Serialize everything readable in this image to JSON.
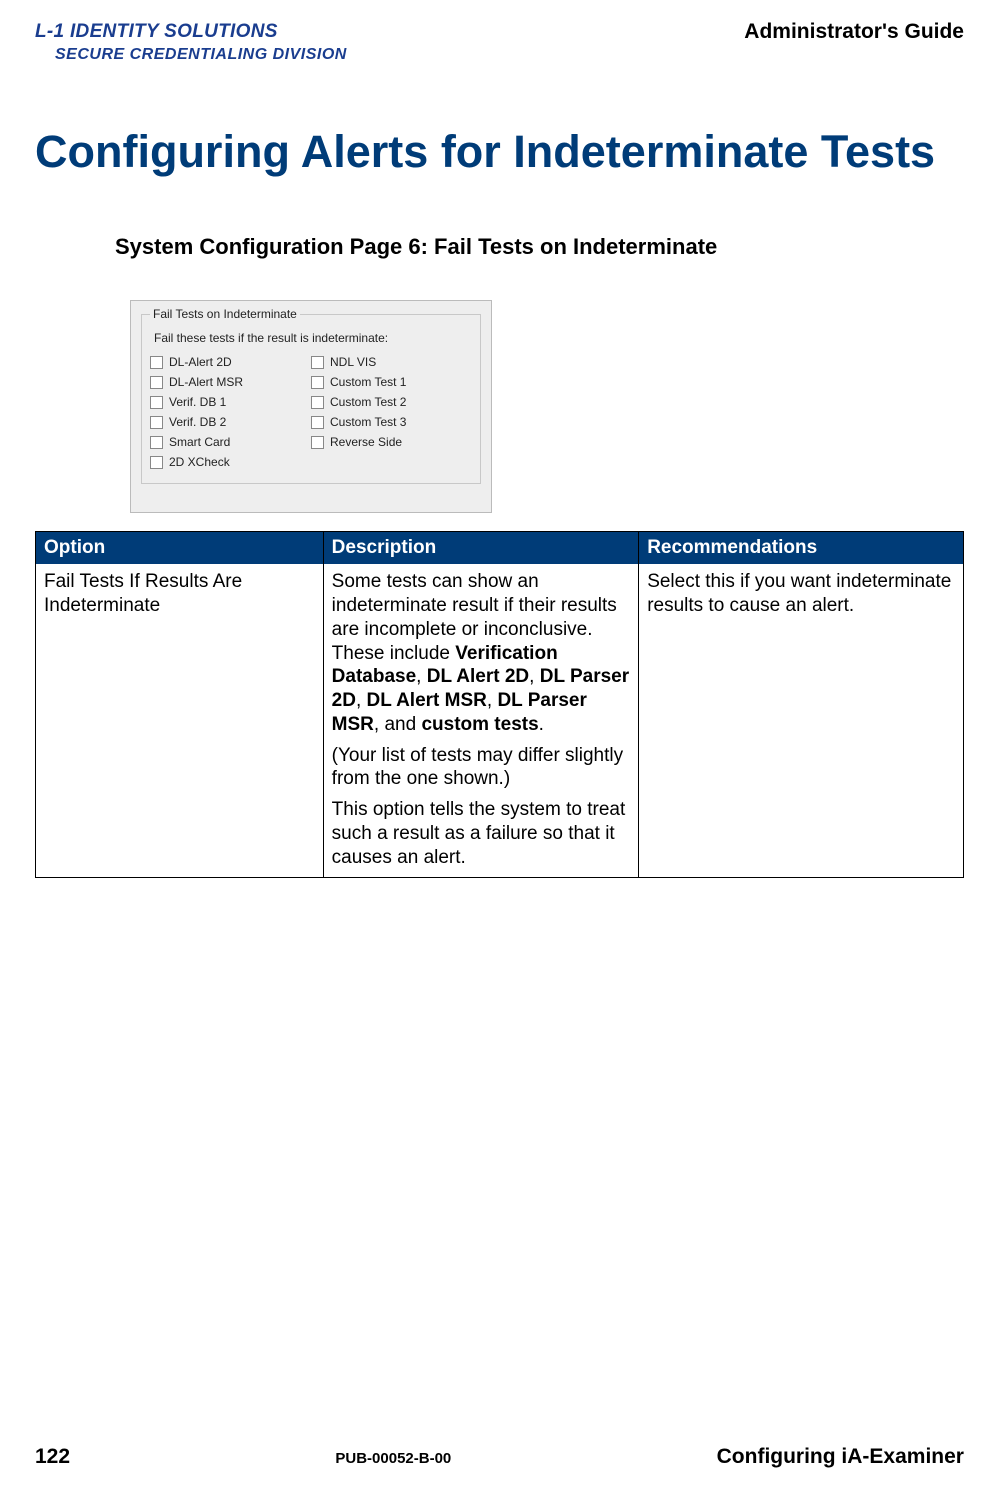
{
  "header": {
    "logo_line1": "L-1 IDENTITY SOLUTIONS",
    "logo_line2": "SECURE CREDENTIALING DIVISION",
    "guide_label": "Administrator's Guide"
  },
  "main_title": "Configuring Alerts for Indeterminate Tests",
  "sub_title": "System Configuration Page 6: Fail Tests on Indeterminate",
  "dialog": {
    "legend": "Fail Tests on Indeterminate",
    "label": "Fail these tests if the result is indeterminate:",
    "left_items": [
      "DL-Alert 2D",
      "DL-Alert MSR",
      "Verif. DB 1",
      "Verif. DB 2",
      "Smart Card",
      "2D XCheck"
    ],
    "right_items": [
      "NDL VIS",
      "Custom Test 1",
      "Custom Test 2",
      "Custom Test 3",
      "Reverse Side"
    ]
  },
  "table": {
    "headers": {
      "option": "Option",
      "description": "Description",
      "recommendations": "Recommendations"
    },
    "row": {
      "option": "Fail Tests If Results Are Indeterminate",
      "desc_p1_prefix": "Some tests can show an indeterminate result if their results are incomplete or inconclusive. These include ",
      "desc_b1": "Verification Database",
      "desc_s1": ", ",
      "desc_b2": "DL Alert 2D",
      "desc_s2": ", ",
      "desc_b3": "DL Parser 2D",
      "desc_s3": ", ",
      "desc_b4": "DL Alert MSR",
      "desc_s4": ", ",
      "desc_b5": "DL Parser MSR",
      "desc_s5": ", and ",
      "desc_b6": "custom tests",
      "desc_s6": ".",
      "desc_p2": "(Your list of tests may differ slightly from the one shown.)",
      "desc_p3": "This option tells the system to treat such a result as a failure so that it causes an alert.",
      "recommendation": "Select this if you want indeterminate results to cause an alert."
    }
  },
  "footer": {
    "page_number": "122",
    "pub_number": "PUB-00052-B-00",
    "section_name": "Configuring iA-Examiner"
  }
}
